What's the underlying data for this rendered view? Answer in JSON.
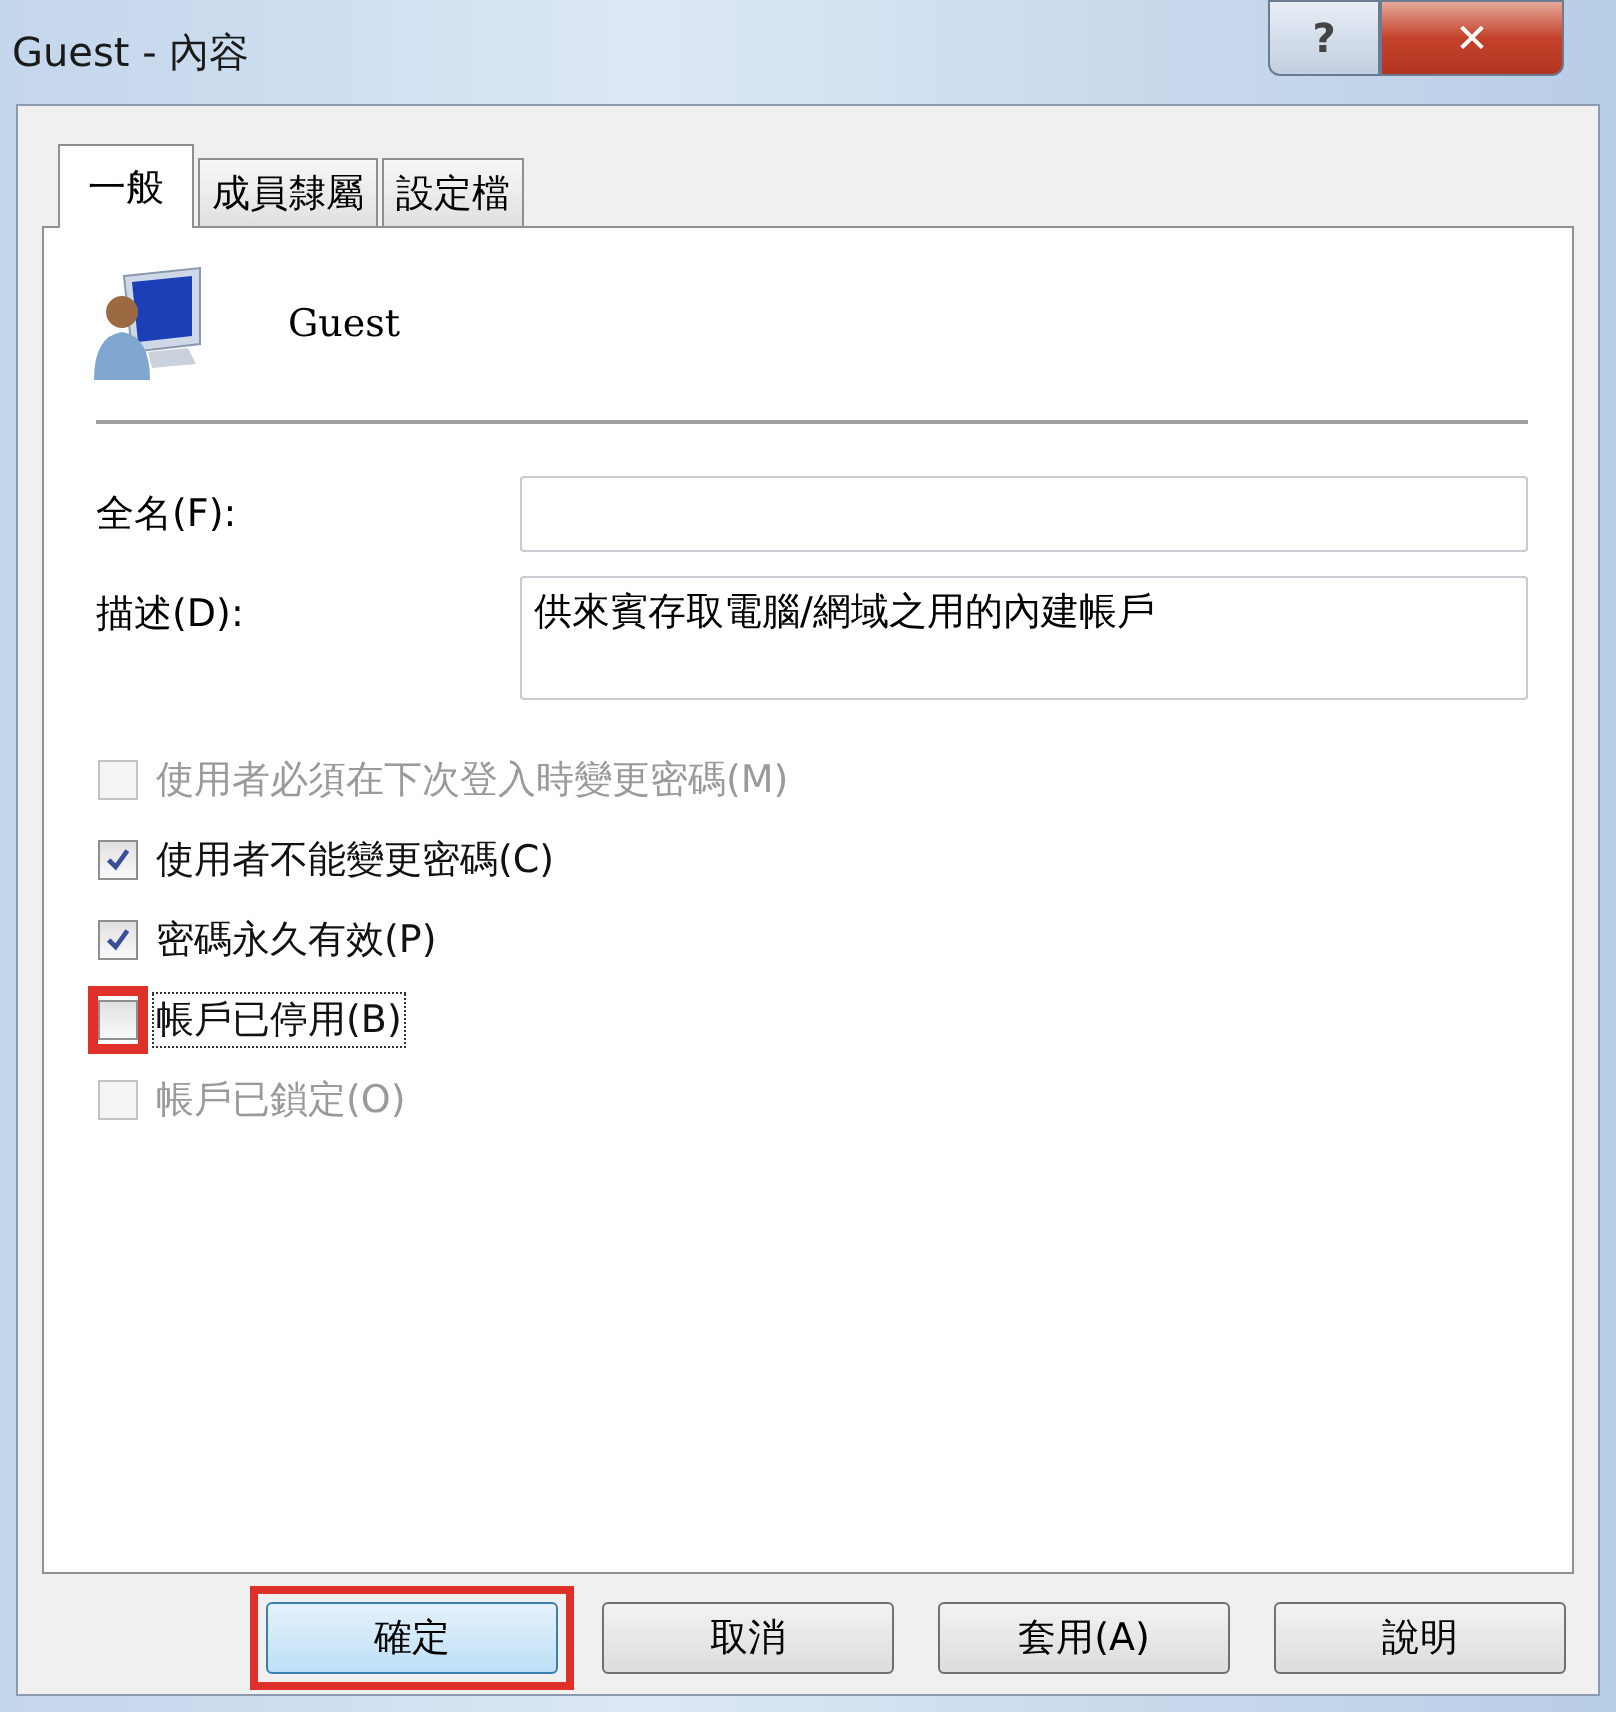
{
  "window": {
    "title": "Guest - 內容",
    "help_button": "?",
    "close_button": "✕"
  },
  "tabs": [
    {
      "label": "一般",
      "selected": true
    },
    {
      "label": "成員隸屬",
      "selected": false
    },
    {
      "label": "設定檔",
      "selected": false
    }
  ],
  "user": {
    "name": "Guest"
  },
  "fields": [
    {
      "label": "全名(F):",
      "multiline": false
    },
    {
      "label": "描述(D):",
      "value": "供來賓存取電腦/網域之用的內建帳戶",
      "multiline": true
    }
  ],
  "checkboxes": [
    {
      "label": "使用者必須在下次登入時變更密碼(M)",
      "checked": false,
      "disabled": true,
      "focused": false,
      "highlighted": false
    },
    {
      "label": "使用者不能變更密碼(C)",
      "checked": true,
      "disabled": false,
      "focused": false,
      "highlighted": false
    },
    {
      "label": "密碼永久有效(P)",
      "checked": true,
      "disabled": false,
      "focused": false,
      "highlighted": false
    },
    {
      "label": "帳戶已停用(B)",
      "checked": false,
      "disabled": false,
      "focused": true,
      "highlighted": true
    },
    {
      "label": "帳戶已鎖定(O)",
      "checked": false,
      "disabled": true,
      "focused": false,
      "highlighted": false
    }
  ],
  "buttons": [
    {
      "label": "確定",
      "default": true,
      "highlighted": true
    },
    {
      "label": "取消",
      "default": false,
      "highlighted": false
    },
    {
      "label": "套用(A)",
      "default": false,
      "highlighted": false
    },
    {
      "label": "說明",
      "default": false,
      "highlighted": false
    }
  ]
}
